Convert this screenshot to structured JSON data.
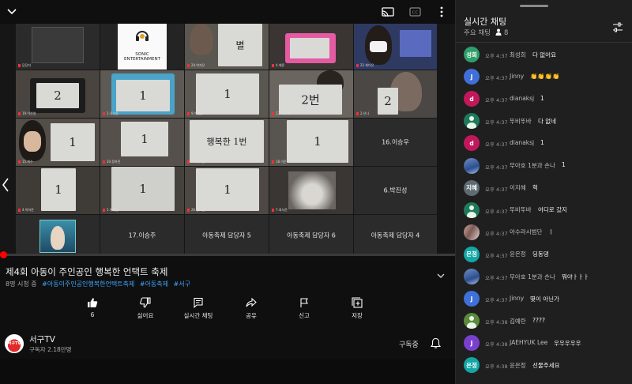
{
  "player": {
    "tiles": [
      {
        "label": "담당자"
      },
      {
        "label": "SONIC ENTERTAINMENT"
      },
      {
        "label": "24.박지은"
      },
      {
        "label": "4.채윤"
      },
      {
        "label": "22.최다은"
      },
      {
        "label": "19.이선영",
        "paper": "2"
      },
      {
        "label": "1.유시윤",
        "paper": "1"
      },
      {
        "label": "9.이정은",
        "paper": "1"
      },
      {
        "label": "13.박하나",
        "paper": "2번"
      },
      {
        "label": "2.은나",
        "paper": "2"
      },
      {
        "label": "15.최수",
        "paper": "1"
      },
      {
        "label": "20.정하린",
        "paper": "1"
      },
      {
        "label": "21.최소윤",
        "paper": "행복한 1번"
      },
      {
        "label": "18.이준",
        "paper": "1"
      },
      {
        "label": "16.이승우"
      },
      {
        "label": "4.박하준",
        "paper": "1"
      },
      {
        "label": "5.박혜성",
        "paper": "1"
      },
      {
        "label": "26.정소윤",
        "paper": "1"
      },
      {
        "label": "7.최서윤"
      },
      {
        "label": "6.박진성"
      },
      {
        "label": ""
      },
      {
        "label": "17.이승주"
      },
      {
        "label": "아동축제 담당자 5"
      },
      {
        "label": "아동축제 담당자 6"
      },
      {
        "label": "아동축제 담당자 4"
      }
    ],
    "progress_fraction": 0.0
  },
  "video": {
    "title": "제4회 아동이 주인공인 행복한 언택트 축제",
    "viewers": "8명 시청 중",
    "tags": [
      "#아동이주인공인행복한언택트축제",
      "#아동축제",
      "#서구"
    ]
  },
  "actions": [
    {
      "label": "6",
      "icon": "like-icon"
    },
    {
      "label": "싫어요",
      "icon": "dislike-icon"
    },
    {
      "label": "실시간 채팅",
      "icon": "live-chat-icon"
    },
    {
      "label": "공유",
      "icon": "share-icon"
    },
    {
      "label": "신고",
      "icon": "flag-icon"
    },
    {
      "label": "저장",
      "icon": "save-icon"
    }
  ],
  "channel": {
    "avatar_text": "서구TV",
    "name": "서구TV",
    "subscribers": "구독자 2.18만명",
    "subscribed_label": "구독중"
  },
  "chat": {
    "title": "실시간 채팅",
    "mode": "주요 채팅",
    "viewer_count": "8",
    "messages": [
      {
        "avatar": "성희",
        "avatar_color": "#2e9e6a",
        "time": "오후 4:37",
        "author": "최성희",
        "text": "다 없어요"
      },
      {
        "avatar": "J",
        "avatar_color": "#3f6fd8",
        "time": "오후 4:37",
        "author": "Jinny",
        "text": "👏👏👏👏"
      },
      {
        "avatar": "d",
        "avatar_color": "#c2185b",
        "time": "오후 4:37",
        "author": "dianaksj",
        "text": "1"
      },
      {
        "avatar": "",
        "avatar_color": "#1f7a5c",
        "avatar_type": "person",
        "time": "오후 4:37",
        "author": "뚜비뚜바",
        "text": "다 없네"
      },
      {
        "avatar": "d",
        "avatar_color": "#c2185b",
        "time": "오후 4:37",
        "author": "dianaksj",
        "text": "1"
      },
      {
        "avatar": "",
        "avatar_color": "#4b6fb0",
        "avatar_type": "photo-sky",
        "time": "오후 4:37",
        "author": "무아호 1분과 손나",
        "text": "1"
      },
      {
        "avatar": "지혜",
        "avatar_color": "#5f6b73",
        "time": "오후 4:37",
        "author": "이지혜",
        "text": "헉"
      },
      {
        "avatar": "",
        "avatar_color": "#1f7a5c",
        "avatar_type": "person",
        "time": "오후 4:37",
        "author": "뚜비뚜바",
        "text": "어디로 갔지"
      },
      {
        "avatar": "",
        "avatar_color": "#8a6a63",
        "avatar_type": "photo-group",
        "time": "오후 4:37",
        "author": "아수라시범단",
        "text": "ㅣ"
      },
      {
        "avatar": "은정",
        "avatar_color": "#13a6a6",
        "time": "오후 4:37",
        "author": "윤은정",
        "text": "딩동댕"
      },
      {
        "avatar": "",
        "avatar_color": "#4b6fb0",
        "avatar_type": "photo-sky",
        "time": "오후 4:37",
        "author": "무아호 1분과 손나",
        "text": "뭐야ㅏㅏㅏ"
      },
      {
        "avatar": "J",
        "avatar_color": "#3f6fd8",
        "time": "오후 4:37",
        "author": "Jinny",
        "text": "몇이 아닌가"
      },
      {
        "avatar": "",
        "avatar_color": "#5c8a3c",
        "avatar_type": "person",
        "time": "오후 4:38",
        "author": "김예란",
        "text": "????"
      },
      {
        "avatar": "J",
        "avatar_color": "#7b3fd0",
        "time": "오후 4:38",
        "author": "JAEHYUK Lee",
        "text": "우우우우우"
      },
      {
        "avatar": "은정",
        "avatar_color": "#13a6a6",
        "time": "오후 4:38",
        "author": "윤은정",
        "text": "선물주세요"
      }
    ]
  }
}
